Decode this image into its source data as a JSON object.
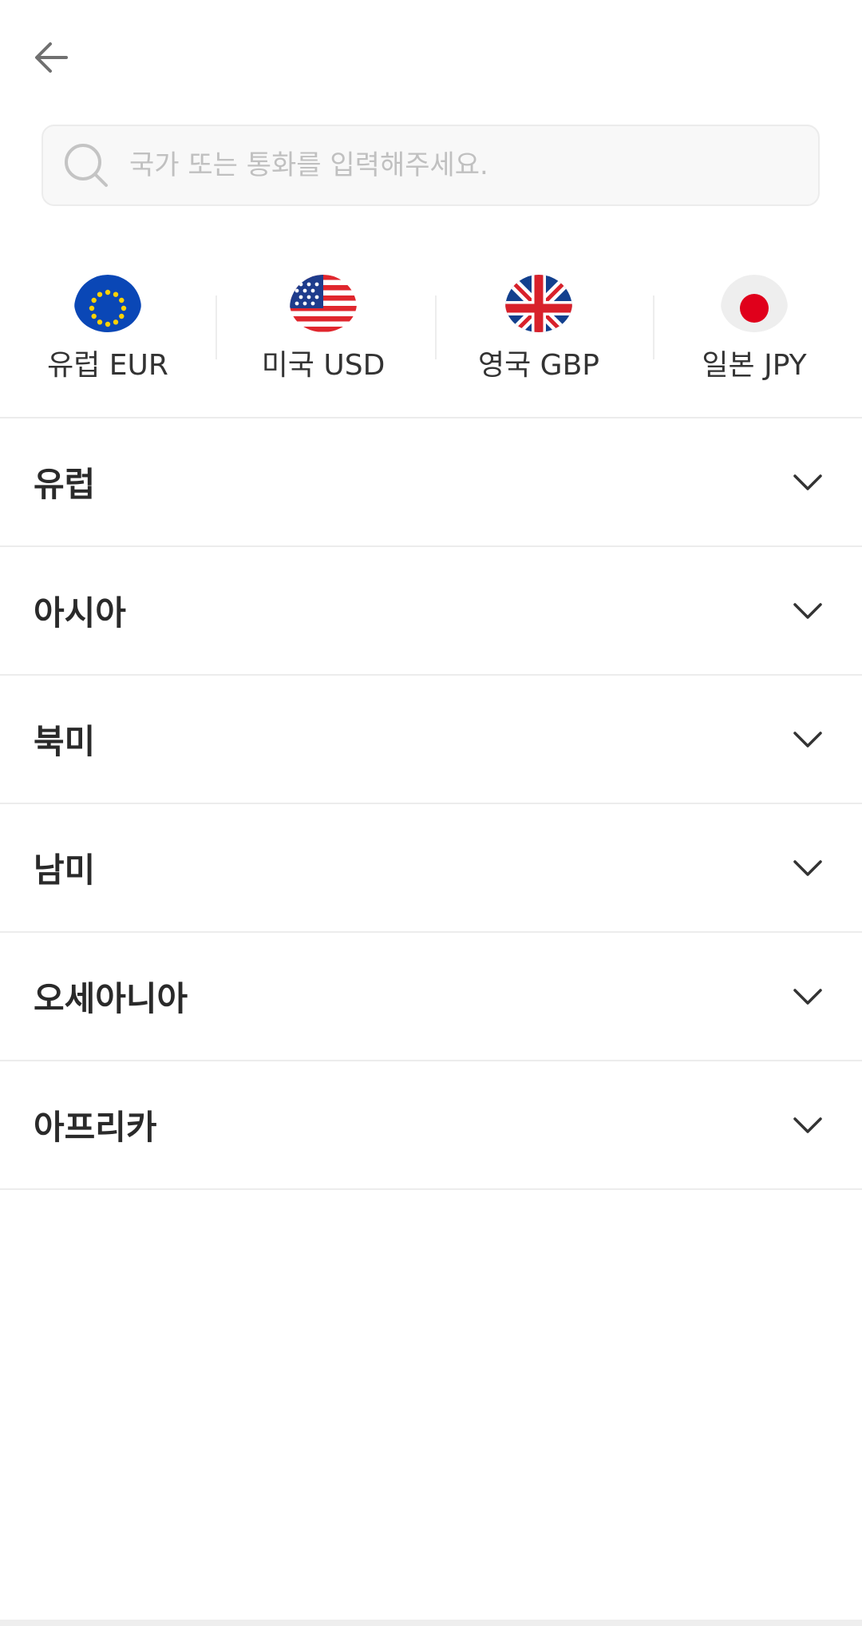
{
  "header": {
    "back_icon": "arrow-left-icon"
  },
  "search": {
    "placeholder": "국가 또는 통화를 입력해주세요.",
    "icon": "search-icon"
  },
  "quick_currencies": [
    {
      "label": "유럽 EUR",
      "flag": "eu-flag-icon"
    },
    {
      "label": "미국 USD",
      "flag": "us-flag-icon"
    },
    {
      "label": "영국 GBP",
      "flag": "uk-flag-icon"
    },
    {
      "label": "일본 JPY",
      "flag": "jp-flag-icon"
    }
  ],
  "regions": [
    {
      "label": "유럽"
    },
    {
      "label": "아시아"
    },
    {
      "label": "북미"
    },
    {
      "label": "남미"
    },
    {
      "label": "오세아니아"
    },
    {
      "label": "아프리카"
    }
  ],
  "colors": {
    "text": "#2a2a2a",
    "divider": "#ececec",
    "search_bg": "#f8f8f8",
    "placeholder": "#c0c0c0"
  }
}
